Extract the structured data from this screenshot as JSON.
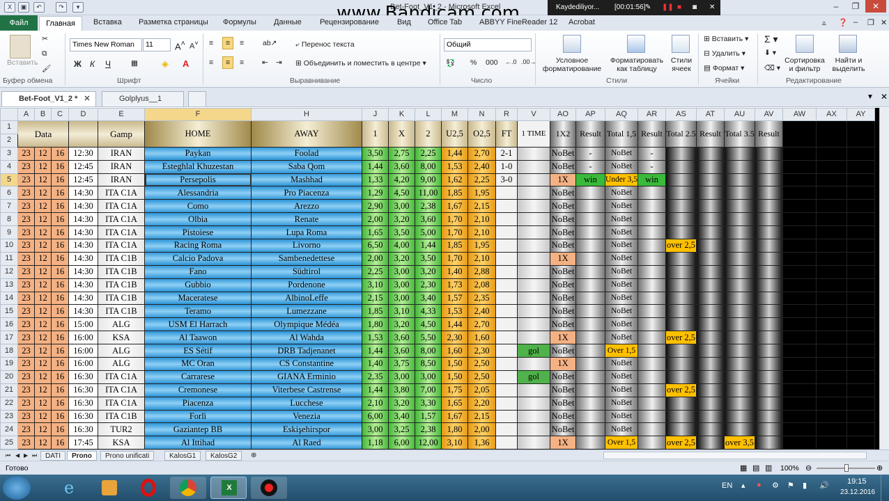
{
  "window": {
    "title": "Bet-Foot_V1_2 - Microsoft Excel",
    "watermark": "www.Bandicam.com",
    "recorder_status": "Kaydediliyor...",
    "recorder_time": "[00:01:56]"
  },
  "ribbon_tabs": [
    "Файл",
    "Главная",
    "Вставка",
    "Разметка страницы",
    "Формулы",
    "Данные",
    "Рецензирование",
    "Вид",
    "Office Tab",
    "ABBYY FineReader 12",
    "Acrobat"
  ],
  "ribbon": {
    "clipboard_paste": "Вставить",
    "clipboard_label": "Буфер обмена",
    "font_name": "Times New Roman",
    "font_size": "11",
    "font_label": "Шрифт",
    "bold": "Ж",
    "italic": "К",
    "underline": "Ч",
    "wrap_text": "Перенос текста",
    "merge_center": "Объединить и поместить в центре",
    "align_label": "Выравнивание",
    "number_format": "Общий",
    "number_label": "Число",
    "cond_format": "Условное форматирование",
    "format_table": "Форматировать как таблицу",
    "cell_styles": "Стили ячеек",
    "styles_label": "Стили",
    "insert": "Вставить",
    "delete": "Удалить",
    "format": "Формат",
    "cells_label": "Ячейки",
    "sort_filter": "Сортировка и фильтр",
    "find_select": "Найти и выделить",
    "edit_label": "Редактирование"
  },
  "workbooks": [
    "Bet-Foot_V1_2 *",
    "Golplyus__1"
  ],
  "columns": [
    "A",
    "B",
    "C",
    "D",
    "E",
    "F",
    "H",
    "J",
    "K",
    "L",
    "M",
    "N",
    "R",
    "V",
    "AO",
    "AP",
    "AQ",
    "AR",
    "AS",
    "AT",
    "AU",
    "AV",
    "AW",
    "AX",
    "AY"
  ],
  "header": {
    "row_nums": [
      "1",
      "2"
    ],
    "data": "Data",
    "gamp": "Gamp",
    "home": "HOME",
    "away": "AWAY",
    "h1": "1",
    "hx": "X",
    "h2": "2",
    "u25": "U2,5",
    "o25": "O2,5",
    "ft": "FT",
    "time1": "1 TIME",
    "x12": "1X2",
    "result": "Result",
    "total15": "Total 1,5",
    "total25": "Total 2.5",
    "total35": "Total 3.5"
  },
  "rows": [
    {
      "r": "3",
      "d": "23",
      "m": "12",
      "y": "16",
      "t": "12:30",
      "g": "IRAN",
      "home": "Paykan",
      "away": "Foolad",
      "o1": "3,50",
      "ox": "2,75",
      "o2": "2,25",
      "u": "1,44",
      "o": "2,70",
      "ft": "2-1",
      "v": "",
      "ao": "NoBet",
      "ap": "-",
      "aq": "NoBet",
      "ar": "-",
      "as": "",
      "au": ""
    },
    {
      "r": "4",
      "d": "23",
      "m": "12",
      "y": "16",
      "t": "12:45",
      "g": "IRAN",
      "home": "Esteghlal Khuzestan",
      "away": "Saba Qom",
      "o1": "1,44",
      "ox": "3,60",
      "o2": "8,00",
      "u": "1,53",
      "o": "2,40",
      "ft": "1-0",
      "v": "",
      "ao": "NoBet",
      "ap": "-",
      "aq": "NoBet",
      "ar": "-",
      "as": "",
      "au": ""
    },
    {
      "r": "5",
      "d": "23",
      "m": "12",
      "y": "16",
      "t": "12:45",
      "g": "IRAN",
      "home": "Persepolis",
      "away": "Mashhad",
      "o1": "1,33",
      "ox": "4,20",
      "o2": "9,00",
      "u": "1,62",
      "o": "2,25",
      "ft": "3-0",
      "v": "",
      "ao": "1X",
      "ap": "win",
      "aq": "Under 3,5",
      "ar": "win",
      "as": "",
      "au": ""
    },
    {
      "r": "6",
      "d": "23",
      "m": "12",
      "y": "16",
      "t": "14:30",
      "g": "ITA C1A",
      "home": "Alessandria",
      "away": "Pro Piacenza",
      "o1": "1,29",
      "ox": "4,50",
      "o2": "11,00",
      "u": "1,85",
      "o": "1,95",
      "ft": "",
      "v": "",
      "ao": "NoBet",
      "ap": "",
      "aq": "NoBet",
      "ar": "",
      "as": "",
      "au": ""
    },
    {
      "r": "7",
      "d": "23",
      "m": "12",
      "y": "16",
      "t": "14:30",
      "g": "ITA C1A",
      "home": "Como",
      "away": "Arezzo",
      "o1": "2,90",
      "ox": "3,00",
      "o2": "2,38",
      "u": "1,67",
      "o": "2,15",
      "ft": "",
      "v": "",
      "ao": "NoBet",
      "ap": "",
      "aq": "NoBet",
      "ar": "",
      "as": "",
      "au": ""
    },
    {
      "r": "8",
      "d": "23",
      "m": "12",
      "y": "16",
      "t": "14:30",
      "g": "ITA C1A",
      "home": "Olbia",
      "away": "Renate",
      "o1": "2,00",
      "ox": "3,20",
      "o2": "3,60",
      "u": "1,70",
      "o": "2,10",
      "ft": "",
      "v": "",
      "ao": "NoBet",
      "ap": "",
      "aq": "NoBet",
      "ar": "",
      "as": "",
      "au": ""
    },
    {
      "r": "9",
      "d": "23",
      "m": "12",
      "y": "16",
      "t": "14:30",
      "g": "ITA C1A",
      "home": "Pistoiese",
      "away": "Lupa Roma",
      "o1": "1,65",
      "ox": "3,50",
      "o2": "5,00",
      "u": "1,70",
      "o": "2,10",
      "ft": "",
      "v": "",
      "ao": "NoBet",
      "ap": "",
      "aq": "NoBet",
      "ar": "",
      "as": "",
      "au": ""
    },
    {
      "r": "10",
      "d": "23",
      "m": "12",
      "y": "16",
      "t": "14:30",
      "g": "ITA C1A",
      "home": "Racing Roma",
      "away": "Livorno",
      "o1": "6,50",
      "ox": "4,00",
      "o2": "1,44",
      "u": "1,85",
      "o": "1,95",
      "ft": "",
      "v": "",
      "ao": "NoBet",
      "ap": "",
      "aq": "NoBet",
      "ar": "",
      "as": "over 2,5",
      "au": ""
    },
    {
      "r": "11",
      "d": "23",
      "m": "12",
      "y": "16",
      "t": "14:30",
      "g": "ITA C1B",
      "home": "Calcio Padova",
      "away": "Sambenedettese",
      "o1": "2,00",
      "ox": "3,20",
      "o2": "3,50",
      "u": "1,70",
      "o": "2,10",
      "ft": "",
      "v": "",
      "ao": "1X",
      "ap": "",
      "aq": "NoBet",
      "ar": "",
      "as": "",
      "au": ""
    },
    {
      "r": "12",
      "d": "23",
      "m": "12",
      "y": "16",
      "t": "14:30",
      "g": "ITA C1B",
      "home": "Fano",
      "away": "Südtirol",
      "o1": "2,25",
      "ox": "3,00",
      "o2": "3,20",
      "u": "1,40",
      "o": "2,88",
      "ft": "",
      "v": "",
      "ao": "NoBet",
      "ap": "",
      "aq": "NoBet",
      "ar": "",
      "as": "",
      "au": ""
    },
    {
      "r": "13",
      "d": "23",
      "m": "12",
      "y": "16",
      "t": "14:30",
      "g": "ITA C1B",
      "home": "Gubbio",
      "away": "Pordenone",
      "o1": "3,10",
      "ox": "3,00",
      "o2": "2,30",
      "u": "1,73",
      "o": "2,08",
      "ft": "",
      "v": "",
      "ao": "NoBet",
      "ap": "",
      "aq": "NoBet",
      "ar": "",
      "as": "",
      "au": ""
    },
    {
      "r": "14",
      "d": "23",
      "m": "12",
      "y": "16",
      "t": "14:30",
      "g": "ITA C1B",
      "home": "Maceratese",
      "away": "AlbinoLeffe",
      "o1": "2,15",
      "ox": "3,00",
      "o2": "3,40",
      "u": "1,57",
      "o": "2,35",
      "ft": "",
      "v": "",
      "ao": "NoBet",
      "ap": "",
      "aq": "NoBet",
      "ar": "",
      "as": "",
      "au": ""
    },
    {
      "r": "15",
      "d": "23",
      "m": "12",
      "y": "16",
      "t": "14:30",
      "g": "ITA C1B",
      "home": "Teramo",
      "away": "Lumezzane",
      "o1": "1,85",
      "ox": "3,10",
      "o2": "4,33",
      "u": "1,53",
      "o": "2,40",
      "ft": "",
      "v": "",
      "ao": "NoBet",
      "ap": "",
      "aq": "NoBet",
      "ar": "",
      "as": "",
      "au": ""
    },
    {
      "r": "16",
      "d": "23",
      "m": "12",
      "y": "16",
      "t": "15:00",
      "g": "ALG",
      "home": "USM El Harrach",
      "away": "Olympique Médéa",
      "o1": "1,80",
      "ox": "3,20",
      "o2": "4,50",
      "u": "1,44",
      "o": "2,70",
      "ft": "",
      "v": "",
      "ao": "NoBet",
      "ap": "",
      "aq": "NoBet",
      "ar": "",
      "as": "",
      "au": ""
    },
    {
      "r": "17",
      "d": "23",
      "m": "12",
      "y": "16",
      "t": "16:00",
      "g": "KSA",
      "home": "Al Taawon",
      "away": "Al Wahda",
      "o1": "1,53",
      "ox": "3,60",
      "o2": "5,50",
      "u": "2,30",
      "o": "1,60",
      "ft": "",
      "v": "",
      "ao": "1X",
      "ap": "",
      "aq": "NoBet",
      "ar": "",
      "as": "over 2,5",
      "au": ""
    },
    {
      "r": "18",
      "d": "23",
      "m": "12",
      "y": "16",
      "t": "16:00",
      "g": "ALG",
      "home": "ES Sétif",
      "away": "DRB Tadjenanet",
      "o1": "1,44",
      "ox": "3,60",
      "o2": "8,00",
      "u": "1,60",
      "o": "2,30",
      "ft": "",
      "v": "gol",
      "ao": "NoBet",
      "ap": "",
      "aq": "Over 1,5",
      "ar": "",
      "as": "",
      "au": ""
    },
    {
      "r": "19",
      "d": "23",
      "m": "12",
      "y": "16",
      "t": "16:00",
      "g": "ALG",
      "home": "MC Oran",
      "away": "CS Constantine",
      "o1": "1,40",
      "ox": "3,75",
      "o2": "8,50",
      "u": "1,50",
      "o": "2,50",
      "ft": "",
      "v": "",
      "ao": "1X",
      "ap": "",
      "aq": "NoBet",
      "ar": "",
      "as": "",
      "au": ""
    },
    {
      "r": "20",
      "d": "23",
      "m": "12",
      "y": "16",
      "t": "16:30",
      "g": "ITA C1A",
      "home": "Carrarese",
      "away": "GIANA Erminio",
      "o1": "2,35",
      "ox": "3,00",
      "o2": "3,00",
      "u": "1,50",
      "o": "2,50",
      "ft": "",
      "v": "gol",
      "ao": "NoBet",
      "ap": "",
      "aq": "NoBet",
      "ar": "",
      "as": "",
      "au": ""
    },
    {
      "r": "21",
      "d": "23",
      "m": "12",
      "y": "16",
      "t": "16:30",
      "g": "ITA C1A",
      "home": "Cremonese",
      "away": "Viterbese Castrense",
      "o1": "1,44",
      "ox": "3,80",
      "o2": "7,00",
      "u": "1,75",
      "o": "2,05",
      "ft": "",
      "v": "",
      "ao": "NoBet",
      "ap": "",
      "aq": "NoBet",
      "ar": "",
      "as": "over 2,5",
      "au": ""
    },
    {
      "r": "22",
      "d": "23",
      "m": "12",
      "y": "16",
      "t": "16:30",
      "g": "ITA C1A",
      "home": "Piacenza",
      "away": "Lucchese",
      "o1": "2,10",
      "ox": "3,20",
      "o2": "3,30",
      "u": "1,65",
      "o": "2,20",
      "ft": "",
      "v": "",
      "ao": "NoBet",
      "ap": "",
      "aq": "NoBet",
      "ar": "",
      "as": "",
      "au": ""
    },
    {
      "r": "23",
      "d": "23",
      "m": "12",
      "y": "16",
      "t": "16:30",
      "g": "ITA C1B",
      "home": "Forlì",
      "away": "Venezia",
      "o1": "6,00",
      "ox": "3,40",
      "o2": "1,57",
      "u": "1,67",
      "o": "2,15",
      "ft": "",
      "v": "",
      "ao": "NoBet",
      "ap": "",
      "aq": "NoBet",
      "ar": "",
      "as": "",
      "au": ""
    },
    {
      "r": "24",
      "d": "23",
      "m": "12",
      "y": "16",
      "t": "16:30",
      "g": "TUR2",
      "home": "Gaziantep BB",
      "away": "Eskişehirspor",
      "o1": "3,00",
      "ox": "3,25",
      "o2": "2,38",
      "u": "1,80",
      "o": "2,00",
      "ft": "",
      "v": "",
      "ao": "NoBet",
      "ap": "",
      "aq": "NoBet",
      "ar": "",
      "as": "",
      "au": ""
    },
    {
      "r": "25",
      "d": "23",
      "m": "12",
      "y": "16",
      "t": "17:45",
      "g": "KSA",
      "home": "Al Ittihad",
      "away": "Al Raed",
      "o1": "1,18",
      "ox": "6,00",
      "o2": "12,00",
      "u": "3,10",
      "o": "1,36",
      "ft": "",
      "v": "",
      "ao": "1X",
      "ap": "",
      "aq": "Over 1,5",
      "ar": "",
      "as": "over 2,5",
      "au": "over 3,5"
    }
  ],
  "sheet_tabs": [
    "DATI",
    "Prono",
    "Prono unificati",
    "KalosG1",
    "KalosG2"
  ],
  "status": {
    "ready": "Готово",
    "zoom": "100%"
  },
  "taskbar": {
    "lang": "EN",
    "time": "19:15",
    "date": "23.12.2016"
  }
}
